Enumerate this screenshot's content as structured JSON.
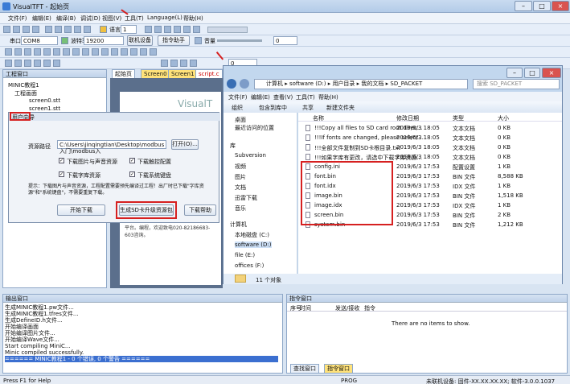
{
  "app": {
    "title": "VisualTFT - 起始页",
    "menu": [
      "文件(F)",
      "编辑(E)",
      "编译(B)",
      "调试(D)",
      "视图(V)",
      "工具(T)",
      "Language(L)",
      "帮助(H)"
    ]
  },
  "toolbar": {
    "zoom": "1",
    "port_label": "串口",
    "port": "COM8",
    "baud_label": "波特率",
    "baud": "19200",
    "connect": "联机设备",
    "cmd_helper": "指令助手",
    "vol_label": "音量",
    "vol": "0",
    "screen_sel": "0"
  },
  "project": {
    "title": "工程窗口",
    "root": "MINIC教程1",
    "node1": "工程画面",
    "node2": "screen0.stt",
    "node3": "screen1.stt"
  },
  "doc_tabs": [
    "起始页",
    "Screen0",
    "Screen1",
    "script.c"
  ],
  "start_page": {
    "logo": "VisualT",
    "text": "建议，可将这里作为VisualTFT开发的交流平台。编程，欢迎致电020-82186683-603咨询。"
  },
  "dialog": {
    "title": "用户向导",
    "path_label": "资源路径",
    "path": "C:\\Users\\jinqingtian\\Desktop\\modbus入门\\modbus入",
    "open": "打开(O)...",
    "cb1": "下载图片与声音资源",
    "cb2": "下载触控配置",
    "cb3": "下载字库资源",
    "cb4": "下载系统键盘",
    "hint": "提示：下载图片与声音资源，工程配置需要预先编译过工程！出厂时已下载\"字库资源\"和\"系统键盘\"，不需要重复下载。",
    "start": "开始下载",
    "gen": "生成SD卡升级资源包",
    "help": "下载帮助"
  },
  "explorer": {
    "crumbs": [
      "计算机",
      "software (D:)",
      "用户目录",
      "我的文档",
      "SD_PACKET"
    ],
    "search": "搜索 SD_PACKET",
    "menu": [
      "文件(F)",
      "编辑(E)",
      "查看(V)",
      "工具(T)",
      "帮助(H)"
    ],
    "cmd": [
      "组织",
      "包含到库中",
      "共享",
      "新建文件夹"
    ],
    "cols": [
      "名称",
      "修改日期",
      "类型",
      "大小"
    ],
    "nav": [
      "桌面",
      "最近访问的位置",
      "库",
      "Subversion",
      "视频",
      "图片",
      "文档",
      "迅雷下载",
      "音乐",
      "计算机",
      "本地磁盘 (C:)",
      "software (D:)",
      "file (E:)",
      "offices (F:)"
    ],
    "files": [
      {
        "name": "!!!Copy all files to SD card root direc...",
        "date": "2019/6/3 18:05",
        "type": "文本文档",
        "size": "0 KB"
      },
      {
        "name": "!!!If fonts are changed, please select...",
        "date": "2019/6/3 18:05",
        "type": "文本文档",
        "size": "0 KB"
      },
      {
        "name": "!!!全部文件复制到SD卡根目录.txt",
        "date": "2019/6/3 18:05",
        "type": "文本文档",
        "size": "0 KB"
      },
      {
        "name": "!!!如果字库有更改，请选中下载字库资源...",
        "date": "2019/6/3 18:05",
        "type": "文本文档",
        "size": "0 KB"
      },
      {
        "name": "config.ini",
        "date": "2019/6/3 17:53",
        "type": "配置设置",
        "size": "1 KB"
      },
      {
        "name": "font.bin",
        "date": "2019/6/3 17:53",
        "type": "BIN 文件",
        "size": "8,588 KB"
      },
      {
        "name": "font.idx",
        "date": "2019/6/3 17:53",
        "type": "IDX 文件",
        "size": "1 KB"
      },
      {
        "name": "image.bin",
        "date": "2019/6/3 17:53",
        "type": "BIN 文件",
        "size": "1,518 KB"
      },
      {
        "name": "image.idx",
        "date": "2019/6/3 17:53",
        "type": "IDX 文件",
        "size": "1 KB"
      },
      {
        "name": "screen.bin",
        "date": "2019/6/3 17:53",
        "type": "BIN 文件",
        "size": "2 KB"
      },
      {
        "name": "system.bin",
        "date": "2019/6/3 17:53",
        "type": "BIN 文件",
        "size": "1,212 KB"
      }
    ],
    "count": "11 个对象"
  },
  "output": {
    "title": "输出窗口",
    "lines": [
      "生成MINIC教程1.pw文件...",
      "生成MINIC教程1.tfres文件...",
      "生成DefineID.h文件...",
      "开始编译画面",
      "开始编译图片文件...",
      "开始编译Wave文件...",
      "Start compiling MiniC...",
      "Minic compiled successfully."
    ],
    "highlight": "====== MINIC教程1 - 0 个错误, 0 个警告 ======"
  },
  "cmdwin": {
    "title": "指令窗口",
    "cols": [
      "序号",
      "时间",
      "发送/接收",
      "指令"
    ],
    "empty": "There are no items to show.",
    "tab1": "查找窗口",
    "tab2": "指令窗口"
  },
  "status": {
    "left": "Press F1 for Help",
    "mid": "PROG",
    "right": "未联机设备: 固件-XX.XX.XX.XX;  软件-3.0.0.1037"
  }
}
